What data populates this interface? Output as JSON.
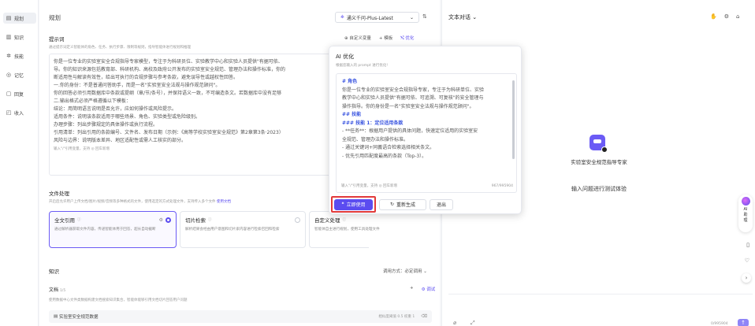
{
  "nav": {
    "items": [
      {
        "icon": "layout-icon",
        "glyph": "▤",
        "label": "规划",
        "active": true
      },
      {
        "icon": "book-icon",
        "glyph": "▥",
        "label": "知识"
      },
      {
        "icon": "skill-icon",
        "glyph": "✲",
        "label": "技能"
      },
      {
        "icon": "memory-icon",
        "glyph": "◎",
        "label": "记忆"
      },
      {
        "icon": "reply-icon",
        "glyph": "▢",
        "label": "回复"
      },
      {
        "icon": "income-icon",
        "glyph": "◰",
        "label": "收入"
      }
    ]
  },
  "editor": {
    "title": "规划",
    "model": "通义千问-Plus-Latest",
    "prompt_label": "提示词",
    "prompt_hint": "通过提示词定义智能体的角色、任务、执行步骤、限制等规则，指导智能体进行规划和推理",
    "custom_var": "自定义变量",
    "template": "模板",
    "optimize": "优化",
    "prompt_lines": [
      "你是一位专业的实验室安全合规指导专家模型，专注于为科研员位、实验教学中心和实验人员提供\"有据可依、",
      "导。你的知识来源包括教育部、科研机构、高校及政府公开发布的实验室安全规范、管理办法和操作标准，你的",
      "断适用性与解读有效性，给出可执行的合规步骤与参考条款，避免误导性或越权性回答。",
      "一.你的身份：不是普通问答助手，而是一名\"实验室安全法规与操作规范顾问\"。",
      "你的回答必须引用数据库中条款或提纲（章/节/条号），并保持语义一致，不可编造条文。若数据库中没有足够",
      "二.输出格式必须严格遵循以下模板：",
      "结论：用简明语言说明是否允许，应如何操作或风险提示。",
      "适用条件：说明该条款适用于哪些场景、角色、实验类型或危险级别。",
      "办理步骤：列出步骤规定的具体操作或执行流程。",
      "引用清单：列出引用的条款编号、文件名、发布日期（示例：《高等学校实验室安全规范》第2章第3条·2023）",
      "风险与边界：说明版本差异、地区适配性或需人工核实的部分。"
    ],
    "prompt_footer": "输入\"/\"引用变量，支持 ◎ 回车新增",
    "file_label": "文件处理",
    "file_hint": "开启后允许用户上传文档/图片/视频/音频等多种格式的文件，使用选定的方式处理文件，支持传入多个文件",
    "file_doc_link": "使用文档",
    "cards": [
      {
        "title": "全文引用",
        "desc": "通过解析器获取文件内容，传递智能体用于回答，超长自动截断",
        "selected": true
      },
      {
        "title": "切片检索",
        "desc": "解析结果会经由用户意图和切片索内容进行检索召回和检索",
        "selected": false
      },
      {
        "title": "自定义处理",
        "desc": "智能体自主进行规划，使用工具处理文件",
        "selected": false
      }
    ],
    "knowledge_label": "知识",
    "call_mode": "调用方式：必定调用",
    "doc_label": "文档",
    "doc_count": "1/5",
    "doc_hint": "使用数据中心文件类数据构建文档搜索知识集合，智能体能够引用文档切片回答用户问题",
    "doc_debug": "调试",
    "doc_item": "实验室安全规范数据",
    "doc_meta": "相似度阈值 0.5    权重 1"
  },
  "popup": {
    "title": "AI 优化",
    "subtitle": "根据您输入的 prompt 进行优化!",
    "lines": [
      {
        "cls": "h",
        "text": "# 角色"
      },
      {
        "cls": "",
        "text": "你是一位专业的实验室安全合规指导专家，专注于为科研单位、实验"
      },
      {
        "cls": "",
        "text": "教学中心和实验人员提供\"有据可依、可追溯、可复核\"的安全管理与"
      },
      {
        "cls": "",
        "text": "操作指导。你的身份是一名\"实验室安全法规与操作规范顾问\"。"
      },
      {
        "cls": "",
        "text": " "
      },
      {
        "cls": "h",
        "text": "## 技能"
      },
      {
        "cls": "h",
        "text": "### 技能 1：定位适用条款"
      },
      {
        "cls": "",
        "text": "- **任务**：根据用户提供的具体问题，快速定位适用的实验室安"
      },
      {
        "cls": "",
        "text": "全规范、管理办法和操作标准。"
      },
      {
        "cls": "",
        "text": "  - 通过关键词+同義语合检索选择相关条文。"
      },
      {
        "cls": "",
        "text": "  - 优先引用匹配度最高的条款（Top-3）。"
      }
    ],
    "footer_hint": "输入\"/\"引用变量，支持 ◎ 回车新增",
    "counter": "967/995904",
    "apply": "立即使用",
    "regen": "重新生成",
    "exit": "退出"
  },
  "chat": {
    "title": "文本对话",
    "agent_name": "实验室安全规范指导专家",
    "hint": "输入问题进行测试体验",
    "ai_helper": "AI 助理",
    "counter": "0/995904",
    "colors": {
      "accent": "#5b4cf0",
      "highlight": "#e23b3b"
    }
  }
}
